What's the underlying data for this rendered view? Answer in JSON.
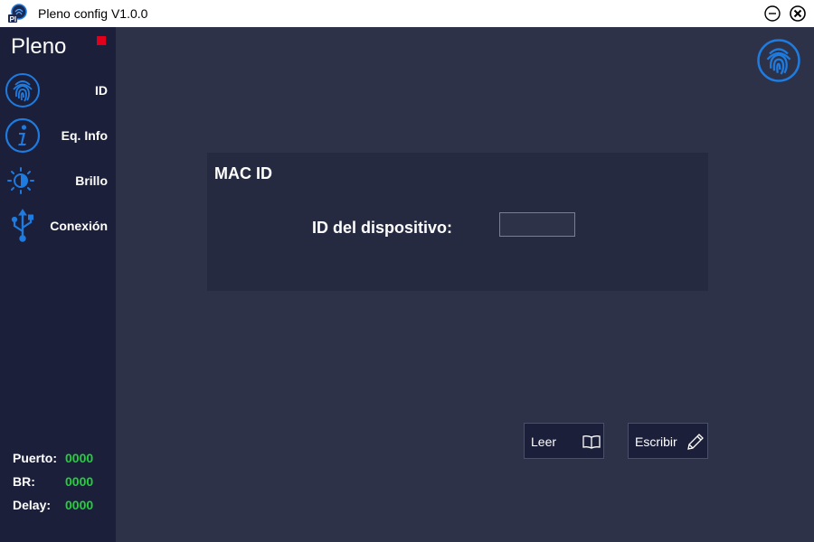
{
  "window": {
    "title": "Pleno config V1.0.0"
  },
  "colors": {
    "accent": "#1e7be0",
    "sidebar_bg": "#1b1f3a",
    "main_bg": "#2e3248",
    "panel_bg": "#262a40",
    "status_red": "#e0001b",
    "value_green": "#22d03a"
  },
  "sidebar": {
    "brand": "Pleno",
    "items": [
      {
        "label": "ID",
        "icon": "fingerprint-icon"
      },
      {
        "label": "Eq. Info",
        "icon": "info-icon"
      },
      {
        "label": "Brillo",
        "icon": "brightness-icon"
      },
      {
        "label": "Conexión",
        "icon": "usb-icon"
      }
    ],
    "info": [
      {
        "label": "Puerto:",
        "value": "0000"
      },
      {
        "label": "BR:",
        "value": "0000"
      },
      {
        "label": "Delay:",
        "value": "0000"
      }
    ]
  },
  "panel": {
    "title": "MAC ID",
    "device_label": "ID del dispositivo:",
    "device_value": ""
  },
  "buttons": {
    "read_label": "Leer",
    "write_label": "Escribir"
  }
}
